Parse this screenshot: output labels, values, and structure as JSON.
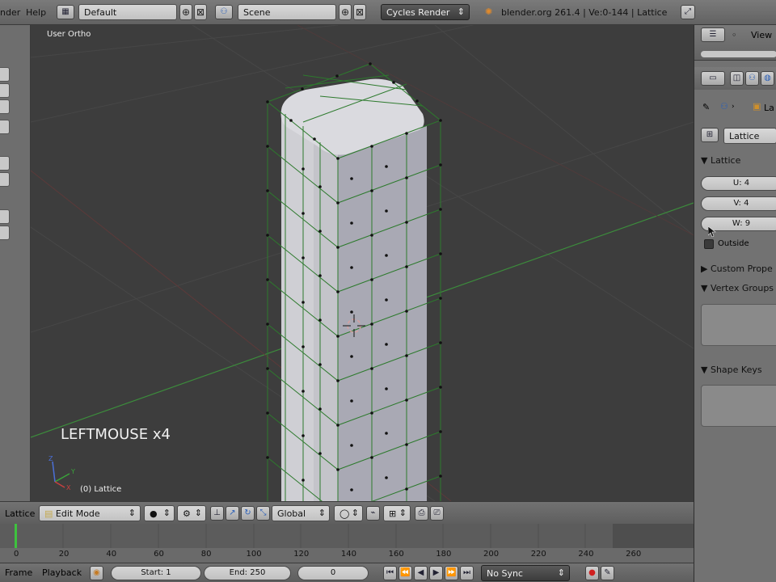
{
  "top_menu": {
    "render_menu": "nder",
    "help_menu": "Help",
    "screen_layout": "Default",
    "scene": "Scene",
    "render_engine": "Cycles Render",
    "info": "blender.org 261.4 | Ve:0-144 | Lattice"
  },
  "viewport": {
    "view_name": "User Ortho",
    "operator_text": "LEFTMOUSE x4",
    "object_info": "(0) Lattice",
    "axis_labels": {
      "x": "X",
      "y": "Y",
      "z": "Z"
    }
  },
  "header_3d": {
    "object_label": "Lattice",
    "mode": "Edit Mode",
    "orientation": "Global"
  },
  "timeline": {
    "ticks": [
      "0",
      "20",
      "40",
      "60",
      "80",
      "100",
      "120",
      "140",
      "160",
      "180",
      "200",
      "220",
      "240",
      "260"
    ],
    "current_frame_fraction": 0.0,
    "menu_frame": "Frame",
    "menu_playback": "Playback",
    "start_frame": "Start: 1",
    "end_frame": "End: 250",
    "current_frame": "0",
    "sync": "No Sync"
  },
  "properties": {
    "view_menu": "View",
    "breadcrumb_object": "La",
    "datablock_name": "Lattice",
    "panel_lattice": "Lattice",
    "u_field": "U: 4",
    "v_field": "V: 4",
    "w_field": "W: 9",
    "outside_label": "Outside",
    "panel_custom_props": "Custom Prope",
    "panel_vertex_groups": "Vertex Groups",
    "panel_shape_keys": "Shape Keys"
  },
  "colors": {
    "viewport_bg": "#3d3d3d",
    "lattice_line": "#2d7a2d",
    "mesh_fill": "#b7b7bd",
    "grid_green_axis": "#3c8c3c",
    "grid_red_axis": "#7a3c3c"
  }
}
